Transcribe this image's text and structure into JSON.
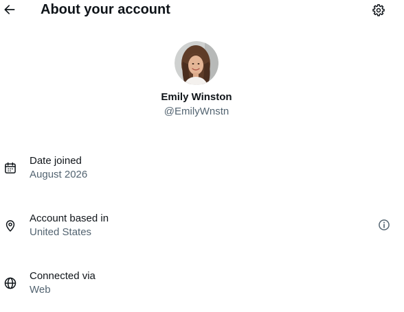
{
  "header": {
    "title": "About your account"
  },
  "profile": {
    "name": "Emily Winston",
    "handle": "@EmilyWnstn"
  },
  "rows": [
    {
      "label": "Date joined",
      "value": "August 2026",
      "icon": "calendar-icon"
    },
    {
      "label": "Account based in",
      "value": "United States",
      "icon": "location-pin-icon",
      "action_icon": "info-icon"
    },
    {
      "label": "Connected via",
      "value": "Web",
      "icon": "globe-icon"
    }
  ],
  "colors": {
    "primary_text": "#0f1419",
    "secondary_text": "#536471",
    "background": "#ffffff"
  }
}
